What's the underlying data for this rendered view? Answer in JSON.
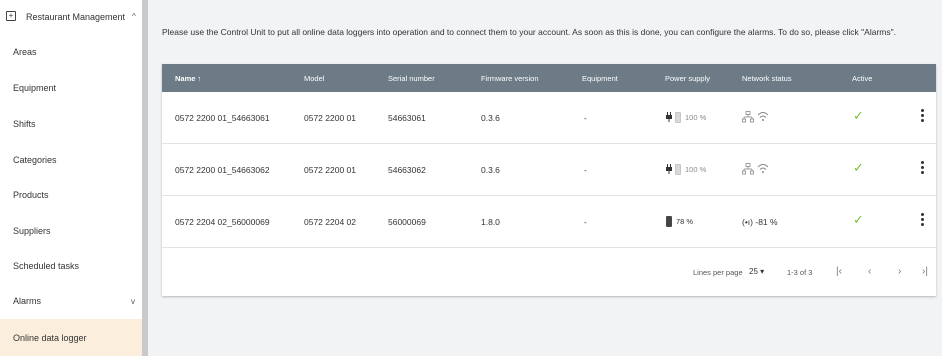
{
  "sidebar": {
    "header": {
      "title": "Restaurant Management",
      "icon": "app-grid-icon",
      "caret": "^"
    },
    "items": [
      {
        "label": "Areas"
      },
      {
        "label": "Equipment"
      },
      {
        "label": "Shifts"
      },
      {
        "label": "Categories"
      },
      {
        "label": "Products"
      },
      {
        "label": "Suppliers"
      },
      {
        "label": "Scheduled tasks"
      },
      {
        "label": "Alarms",
        "chevron": "v"
      },
      {
        "label": "Online data logger",
        "active": true
      }
    ]
  },
  "notice": "Please use the Control Unit to put all online data loggers into operation and to connect them to your account. As soon as this is done, you can configure the alarms. To do so, please click \"Alarms\".",
  "table": {
    "columns": [
      "Name ↑",
      "Model",
      "Serial number",
      "Firmware version",
      "Equipment",
      "Power supply",
      "Network status",
      "Active"
    ],
    "rows": [
      {
        "name": "0572 2200 01_54663061",
        "model": "0572 2200 01",
        "serial": "54663061",
        "firmware": "0.3.6",
        "equipment": "-",
        "power": "100 %",
        "power_type": "plug",
        "network": "",
        "network_type": "ethernet-wifi",
        "active": "✓"
      },
      {
        "name": "0572 2200 01_54663062",
        "model": "0572 2200 01",
        "serial": "54663062",
        "firmware": "0.3.6",
        "equipment": "-",
        "power": "100 %",
        "power_type": "plug",
        "network": "",
        "network_type": "ethernet-wifi",
        "active": "✓"
      },
      {
        "name": "0572 2204 02_56000069",
        "model": "0572 2204 02",
        "serial": "56000069",
        "firmware": "1.8.0",
        "equipment": "-",
        "power": "78 %",
        "power_type": "battery",
        "network": "(•ı) -81 %",
        "network_type": "radio",
        "active": "✓"
      }
    ]
  },
  "pagination": {
    "lines_per_page_label": "Lines per page",
    "lines_per_page_value": "25 ▾",
    "range": "1-3 of 3",
    "first": "|‹",
    "prev": "‹",
    "next": "›",
    "last": "›|"
  },
  "colors": {
    "header": "#6c7b85",
    "active_check": "#7cbf2f",
    "active_sidebar": "#fbeedc"
  }
}
